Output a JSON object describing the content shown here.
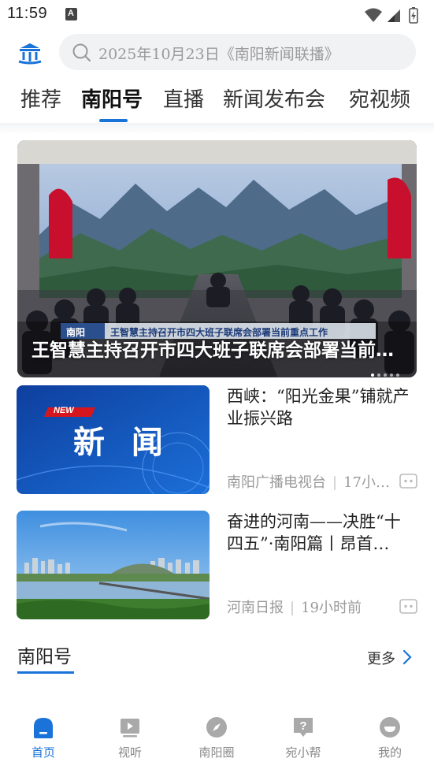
{
  "status_bar": {
    "time": "11:59",
    "notification_letter": "A"
  },
  "header": {
    "search_placeholder": "2025年10月23日《南阳新闻联播》"
  },
  "tabs": [
    {
      "label": "推荐",
      "active": false
    },
    {
      "label": "南阳号",
      "active": true
    },
    {
      "label": "直播",
      "active": false
    },
    {
      "label": "新闻发布会",
      "active": false
    },
    {
      "label": "宛视频",
      "active": false
    }
  ],
  "hero": {
    "title": "王智慧主持召开市四大班子联席会部署当前重点工作",
    "caption_tag": "南阳",
    "caption_text": "王智慧主持召开市四大班子联席会部署当前重点工作",
    "slide_count": 5,
    "active_slide": 1
  },
  "news": [
    {
      "title": "西峡：“阳光金果”铺就产业振兴路",
      "source": "南阳广播电视台",
      "time": "17小…",
      "thumb_badge": "NEW",
      "thumb_text": "新 闻"
    },
    {
      "title": "奋进的河南——决胜“十四五”·南阳篇丨昂首…",
      "source": "河南日报",
      "time": "19小时前"
    }
  ],
  "section": {
    "title": "南阳号",
    "more_label": "更多"
  },
  "bottom_nav": [
    {
      "label": "首页",
      "icon": "home-icon",
      "active": true
    },
    {
      "label": "视听",
      "icon": "video-icon",
      "active": false
    },
    {
      "label": "南阳圈",
      "icon": "compass-icon",
      "active": false
    },
    {
      "label": "宛小帮",
      "icon": "help-icon",
      "active": false
    },
    {
      "label": "我的",
      "icon": "profile-icon",
      "active": false
    }
  ],
  "colors": {
    "accent": "#1a73d9",
    "text": "#222222",
    "muted": "#9a9a9a"
  }
}
